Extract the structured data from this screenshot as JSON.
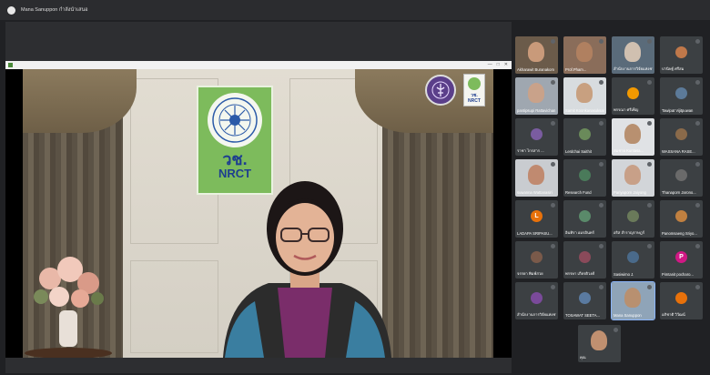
{
  "meeting": {
    "presenter_label": "Mana Sanuppon กำลังนำเสนอ"
  },
  "shared_window": {
    "controls": [
      "—",
      "□",
      "✕"
    ]
  },
  "stage": {
    "sign_thai": "วช.",
    "sign_en": "NRCT",
    "small_logo_thai": "วช.",
    "small_logo_en": "NRCT"
  },
  "participants": [
    {
      "name": "Akharawit Buranakom",
      "type": "video",
      "bg": "#6b5b4a",
      "face": "#c99a7a"
    },
    {
      "name": "Prof.Pham...",
      "type": "video",
      "bg": "#8a6d5a",
      "face": "#b08060"
    },
    {
      "name": "สำนักงานการวิจัยแห่งชาติ",
      "type": "video",
      "bg": "#5a6b7a",
      "face": "#d0c0b0"
    },
    {
      "name": "ปานิษฐ์ ศรีสม",
      "type": "avatar",
      "color": "#c0784a",
      "initial": ""
    },
    {
      "name": "pantipsupi Rattavichan",
      "type": "video",
      "bg": "#9fa7b0",
      "face": "#c9a28a"
    },
    {
      "name": "Samit Koonkanasuksanan",
      "type": "video",
      "bg": "#d8dcdf",
      "face": "#c8a080"
    },
    {
      "name": "พรรณา ศรีเพ็ญ",
      "type": "avatar",
      "color": "#f29900",
      "initial": ""
    },
    {
      "name": "Tawipat Vijitpuwan",
      "type": "avatar",
      "color": "#5c7a99",
      "initial": ""
    },
    {
      "name": "ราชา ไกรสาร ...",
      "type": "avatar",
      "color": "#7a5ca0",
      "initial": ""
    },
    {
      "name": "Lerdchai Saithit",
      "type": "avatar",
      "color": "#6a8a5a",
      "initial": ""
    },
    {
      "name": "สมชาย Kuntasa...",
      "type": "video",
      "bg": "#e0e2e5",
      "face": "#b89070"
    },
    {
      "name": "WASSANA RASE...",
      "type": "avatar",
      "color": "#8a6a4a",
      "initial": ""
    },
    {
      "name": "suwanna Wattanasiri",
      "type": "video",
      "bg": "#c9ccd0",
      "face": "#c08a70"
    },
    {
      "name": "Research Fund",
      "type": "avatar",
      "color": "#4a7a5a",
      "initial": ""
    },
    {
      "name": "Pariyaporn Jaiyong",
      "type": "video",
      "bg": "#d2d5d9",
      "face": "#c8a088"
    },
    {
      "name": "Thanaporn Jarono...",
      "type": "avatar",
      "color": "#6a6a6a",
      "initial": ""
    },
    {
      "name": "LADAPA SRIPASU...",
      "type": "avatar",
      "color": "#e8710a",
      "initial": "L"
    },
    {
      "name": "อินทิรา อมรอินทร์",
      "type": "avatar",
      "color": "#5a8a6a",
      "initial": ""
    },
    {
      "name": "อริส สำราญราษฎร์",
      "type": "avatar",
      "color": "#6a7a5a",
      "initial": ""
    },
    {
      "name": "Panomsaeng Sriyo...",
      "type": "avatar",
      "color": "#c08040",
      "initial": ""
    },
    {
      "name": "จรรยา พิมพ์สวย",
      "type": "avatar",
      "color": "#7a5a4a",
      "initial": ""
    },
    {
      "name": "พรรษา เกียรติวงศ์",
      "type": "avatar",
      "color": "#8a4a5a",
      "initial": ""
    },
    {
      "name": "Sasiwimo J.",
      "type": "avatar",
      "color": "#4a6a8a",
      "initial": ""
    },
    {
      "name": "Pimtanit pocharo...",
      "type": "avatar",
      "color": "#d01884",
      "initial": "P"
    },
    {
      "name": "สำนักงานการวิจัยแห่งชาติ",
      "type": "avatar",
      "color": "#7a4a9a",
      "initial": ""
    },
    {
      "name": "TOSAWAT SEETA...",
      "type": "avatar",
      "color": "#5a7aa0",
      "initial": ""
    },
    {
      "name": "Mana Sanuppon",
      "type": "video",
      "bg": "#8fa4b8",
      "face": "#b89070",
      "active": true
    },
    {
      "name": "อภิชาติ วิวัฒน์",
      "type": "avatar",
      "color": "#e8710a",
      "initial": ""
    },
    {
      "name": "คุณ",
      "type": "video",
      "bg": "#3c4043",
      "face": "#c09070"
    }
  ]
}
